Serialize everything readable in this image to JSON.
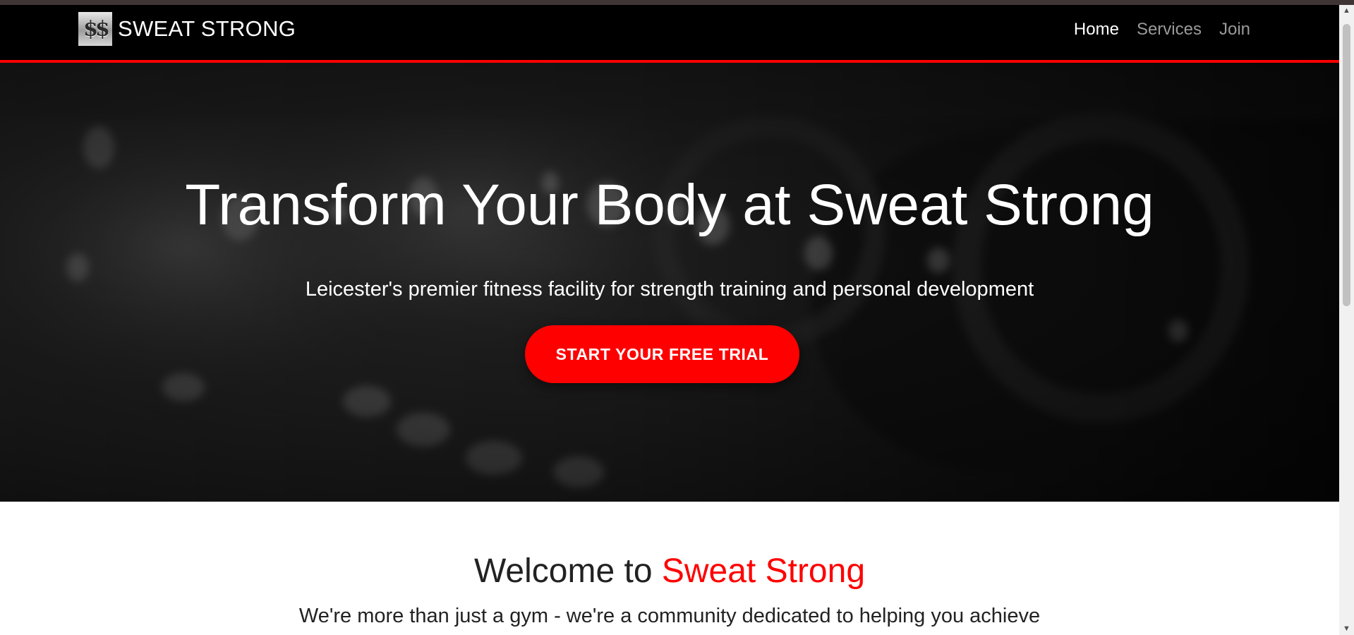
{
  "navbar": {
    "logo_glyph": "$$",
    "brand": "SWEAT STRONG",
    "links": [
      {
        "label": "Home",
        "active": true
      },
      {
        "label": "Services",
        "active": false
      },
      {
        "label": "Join",
        "active": false
      }
    ]
  },
  "hero": {
    "title": "Transform Your Body at Sweat Strong",
    "subtitle": "Leicester's premier fitness facility for strength training and personal development",
    "cta": "START YOUR FREE TRIAL",
    "background_icon": "blurred-gym-equipment-photo"
  },
  "welcome": {
    "title_prefix": "Welcome to ",
    "title_accent": "Sweat Strong",
    "text": "We're more than just a gym - we're a community dedicated to helping you achieve"
  },
  "scrollbar": {
    "up_glyph": "▲",
    "down_glyph": "▼"
  },
  "colors": {
    "accent": "#ff0000",
    "navbar_bg": "#000000",
    "text_dark": "#222222",
    "nav_inactive": "#9a9a9a"
  }
}
